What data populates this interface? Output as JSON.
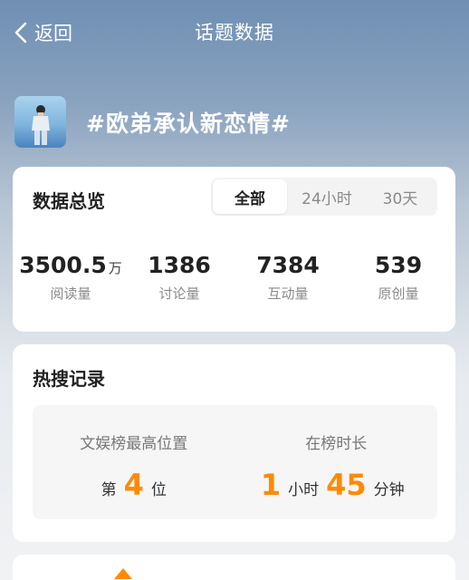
{
  "header": {
    "back_label": "返回",
    "title": "话题数据"
  },
  "topic": {
    "name": "#欧弟承认新恋情#"
  },
  "overview": {
    "title": "数据总览",
    "tabs": [
      {
        "label": "全部",
        "active": true
      },
      {
        "label": "24小时",
        "active": false
      },
      {
        "label": "30天",
        "active": false
      }
    ],
    "stats": [
      {
        "value": "3500.5",
        "unit": "万",
        "label": "阅读量"
      },
      {
        "value": "1386",
        "unit": "",
        "label": "讨论量"
      },
      {
        "value": "7384",
        "unit": "",
        "label": "互动量"
      },
      {
        "value": "539",
        "unit": "",
        "label": "原创量"
      }
    ]
  },
  "hot_search": {
    "title": "热搜记录",
    "best_rank": {
      "label": "文娱榜最高位置",
      "prefix": "第",
      "value": "4",
      "suffix": "位"
    },
    "duration": {
      "label": "在榜时长",
      "hours": "1",
      "hours_unit": "小时",
      "minutes": "45",
      "minutes_unit": "分钟"
    }
  },
  "colors": {
    "accent": "#ff8a00",
    "text": "#222222",
    "muted": "#8a8a8a"
  }
}
